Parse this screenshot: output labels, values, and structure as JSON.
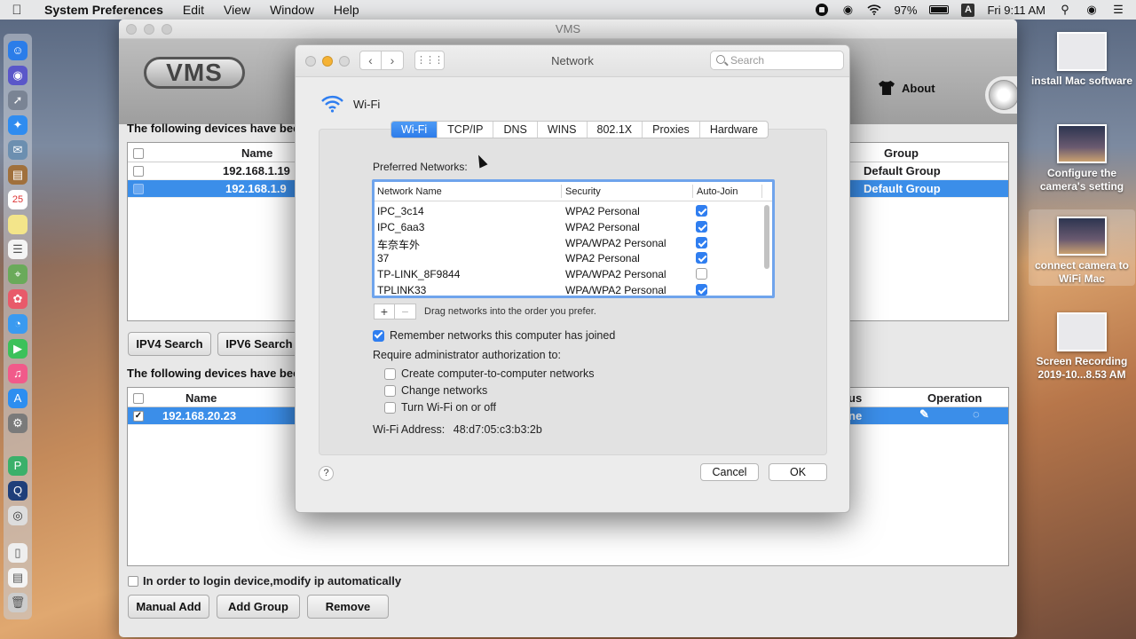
{
  "menubar": {
    "app": "System Preferences",
    "items": [
      "Edit",
      "View",
      "Window",
      "Help"
    ],
    "battery": "97%",
    "input_source": "A",
    "clock": "Fri 9:11 AM"
  },
  "desktop": {
    "items": [
      {
        "label": "install Mac software"
      },
      {
        "label": "Configure the camera's setting"
      },
      {
        "label": "connect camera to WiFi Mac"
      },
      {
        "label": "Screen Recording 2019-10...8.53 AM"
      }
    ],
    "counter": "0"
  },
  "vms": {
    "window_title": "VMS",
    "logo": "VMS",
    "about_label": "About",
    "section1_label": "The following devices have been",
    "table1": {
      "headers": {
        "name": "Name",
        "group": "Group"
      },
      "rows": [
        {
          "ip": "192.168.1.19",
          "group": "Default Group",
          "selected": false
        },
        {
          "ip": "192.168.1.9",
          "group": "Default Group",
          "selected": true
        }
      ]
    },
    "ipv4_button": "IPV4 Search",
    "ipv6_button": "IPV6 Search",
    "section2_label": "The following devices have been",
    "table2": {
      "headers": {
        "name": "Name",
        "status": "us",
        "operation": "Operation"
      },
      "rows": [
        {
          "ip": "192.168.20.23",
          "status": "ne",
          "checked": true
        }
      ]
    },
    "auto_ip_label": "In order to login device,modify ip automatically",
    "manual_add_button": "Manual Add",
    "add_group_button": "Add Group",
    "remove_button": "Remove"
  },
  "network": {
    "title": "Network",
    "search_placeholder": "Search",
    "interface_name": "Wi-Fi",
    "tabs": [
      {
        "label": "Wi-Fi",
        "active": true
      },
      {
        "label": "TCP/IP",
        "active": false
      },
      {
        "label": "DNS",
        "active": false
      },
      {
        "label": "WINS",
        "active": false
      },
      {
        "label": "802.1X",
        "active": false
      },
      {
        "label": "Proxies",
        "active": false
      },
      {
        "label": "Hardware",
        "active": false
      }
    ],
    "preferred_label": "Preferred Networks:",
    "table_headers": {
      "name": "Network Name",
      "security": "Security",
      "autojoin": "Auto-Join"
    },
    "networks": [
      {
        "name": "IPC_3c14",
        "security": "WPA2 Personal",
        "auto_join": true
      },
      {
        "name": "IPC_6aa3",
        "security": "WPA2 Personal",
        "auto_join": true
      },
      {
        "name": "车奈车外",
        "security": "WPA/WPA2 Personal",
        "auto_join": true
      },
      {
        "name": "37",
        "security": "WPA2 Personal",
        "auto_join": true
      },
      {
        "name": "TP-LINK_8F9844",
        "security": "WPA/WPA2 Personal",
        "auto_join": false
      },
      {
        "name": "TPLINK33",
        "security": "WPA/WPA2 Personal",
        "auto_join": true
      }
    ],
    "add_symbol": "+",
    "remove_symbol": "−",
    "drag_hint": "Drag networks into the order you prefer.",
    "remember_label": "Remember networks this computer has joined",
    "remember_checked": true,
    "require_label": "Require administrator authorization to:",
    "admin_options": [
      {
        "label": "Create computer-to-computer networks",
        "checked": false
      },
      {
        "label": "Change networks",
        "checked": false
      },
      {
        "label": "Turn Wi-Fi on or off",
        "checked": false
      }
    ],
    "wifi_address_label": "Wi-Fi Address:",
    "wifi_address": "48:d7:05:c3:b3:2b",
    "help_symbol": "?",
    "cancel_button": "Cancel",
    "ok_button": "OK"
  },
  "colors": {
    "accent": "#2f7ef0",
    "selection": "#3b8ee9"
  }
}
